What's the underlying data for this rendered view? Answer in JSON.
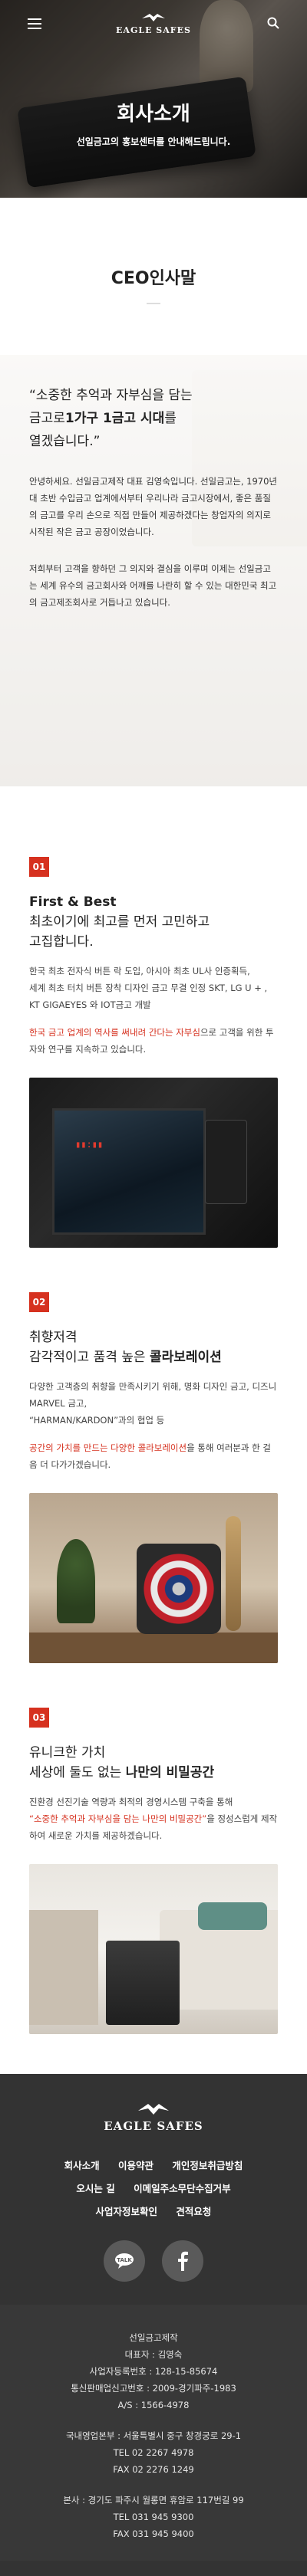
{
  "header": {
    "logo_text": "EAGLE SAFES",
    "hero_title": "회사소개",
    "hero_subtitle": "선일금고의 홍보센터를 안내해드립니다."
  },
  "ceo": {
    "heading": "CEO인사말",
    "quote_line1": "“소중한 추억과 자부심을 담는",
    "quote_line2_pre": "금고로",
    "quote_line2_bold": "1가구 1금고 시대",
    "quote_line2_post": "를",
    "quote_line3": "열겠습니다.”",
    "para1": "안녕하세요. 선일금고제작 대표 김영숙입니다. 선일금고는, 1970년 대 초반 수입금고 업계에서부터 우리나라 금고시장에서, 좋은 품질의 금고를 우리 손으로 직접 만들어 제공하겠다는 창업자의 의지로 시작된 작은 금고 공장이었습니다.",
    "para2": "저희부터 고객을 향하던 그 의지와 결심을 이루며 이제는 선일금고는 세계 유수의 금고회사와 어깨를 나란히 할 수 있는 대한민국 최고의 금고제조회사로 거듭나고 있습니다."
  },
  "sections": [
    {
      "num": "01",
      "title_line1": "First & Best",
      "title_line2": "최초이기에 최고를 먼저 고민하고",
      "title_line3": "고집합니다.",
      "body1": "한국 최초 전자식 버튼 락 도입, 아시아 최초 UL사 인증획득,",
      "body2": "세계 최초 터치 버튼 장착 디자인 금고 무결 인정 SKT, LG U + , KT GIGAEYES 와 IOT금고 개발",
      "red_text": "한국 금고 업계의 역사를 써내려 간다는 자부심",
      "body3": "으로 고객을 위한 투자와 연구를 지속하고 있습니다."
    },
    {
      "num": "02",
      "title_line1": "취향저격",
      "title_line2_pre": "감각적이고 품격 높은 ",
      "title_line2_bold": "콜라보레이션",
      "body1": "다양한 고객층의 취향을 만족시키기 위해, 명화 디자인 금고, 디즈니 MARVEL 금고,",
      "body2": "“HARMAN/KARDON”과의 협업 등",
      "red_text": "공간의 가치를 만드는 다양한 콜라보레이션",
      "body3": "을 통해 여러분과 한 걸음 더 다가가겠습니다."
    },
    {
      "num": "03",
      "title_line1": "유니크한 가치",
      "title_line2_pre": "세상에 둘도 없는 ",
      "title_line2_bold": "나만의 비밀공간",
      "body1": "진환경 선진기술 역량과 최적의 경영시스템 구축을 통해",
      "red_text": "“소중한 추억과 자부심을 담는 나만의 비밀공간”",
      "body3": "을 정성스럽게 제작하여 새로운 가치를 제공하겠습니다."
    }
  ],
  "footer": {
    "logo_text": "EAGLE SAFES",
    "links_row1": [
      "회사소개",
      "이용약관",
      "개인정보취급방침"
    ],
    "links_row2": [
      "오시는 길",
      "이메일주소무단수집거부"
    ],
    "links_row3": [
      "사업자정보확인",
      "견적요청"
    ],
    "info": {
      "company": "선일금고제작",
      "ceo": "대표자 : 김영숙",
      "biz_no": "사업자등록번호 : 128-15-85674",
      "sales_no": "통신판매업신고번호 : 2009-경기파주-1983",
      "as": "A/S : 1566-4978",
      "sales_office": "국내영업본부 : 서울특별시 중구 창경궁로 29-1",
      "tel1": "TEL 02 2267 4978",
      "fax1": "FAX 02 2276 1249",
      "hq": "본사 : 경기도 파주시 월롱면 휴암로 117번길 99",
      "tel2": "TEL 031 945 9300",
      "fax2": "FAX 031 945 9400"
    }
  }
}
